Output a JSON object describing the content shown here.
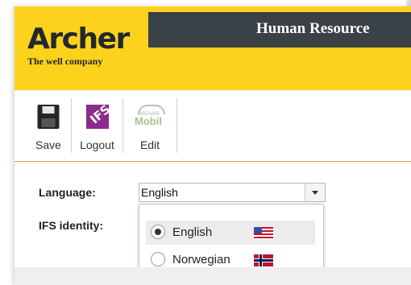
{
  "brand": {
    "name": "Archer",
    "tagline": "The well company"
  },
  "app": {
    "title": "Human Resource"
  },
  "toolbar": {
    "items": [
      {
        "label": "Save",
        "icon": "save-icon"
      },
      {
        "label": "Logout",
        "icon": "ifs-logout-icon"
      },
      {
        "label": "Edit",
        "icon": "openair-mobil-icon",
        "icon_text_small": "OPENAIR",
        "icon_text": "Mobil"
      }
    ]
  },
  "form": {
    "language_label": "Language:",
    "language_value": "English",
    "identity_label": "IFS identity:",
    "identity_value_fragment": ")"
  },
  "language_dropdown": {
    "options": [
      {
        "label": "English",
        "selected": true,
        "flag": "us-flag-icon"
      },
      {
        "label": "Norwegian",
        "selected": false,
        "flag": "norway-flag-icon"
      }
    ]
  },
  "colors": {
    "brand_yellow": "#fcd21c",
    "title_bar": "#3a4147",
    "ifs_purple": "#8a2b8d"
  }
}
